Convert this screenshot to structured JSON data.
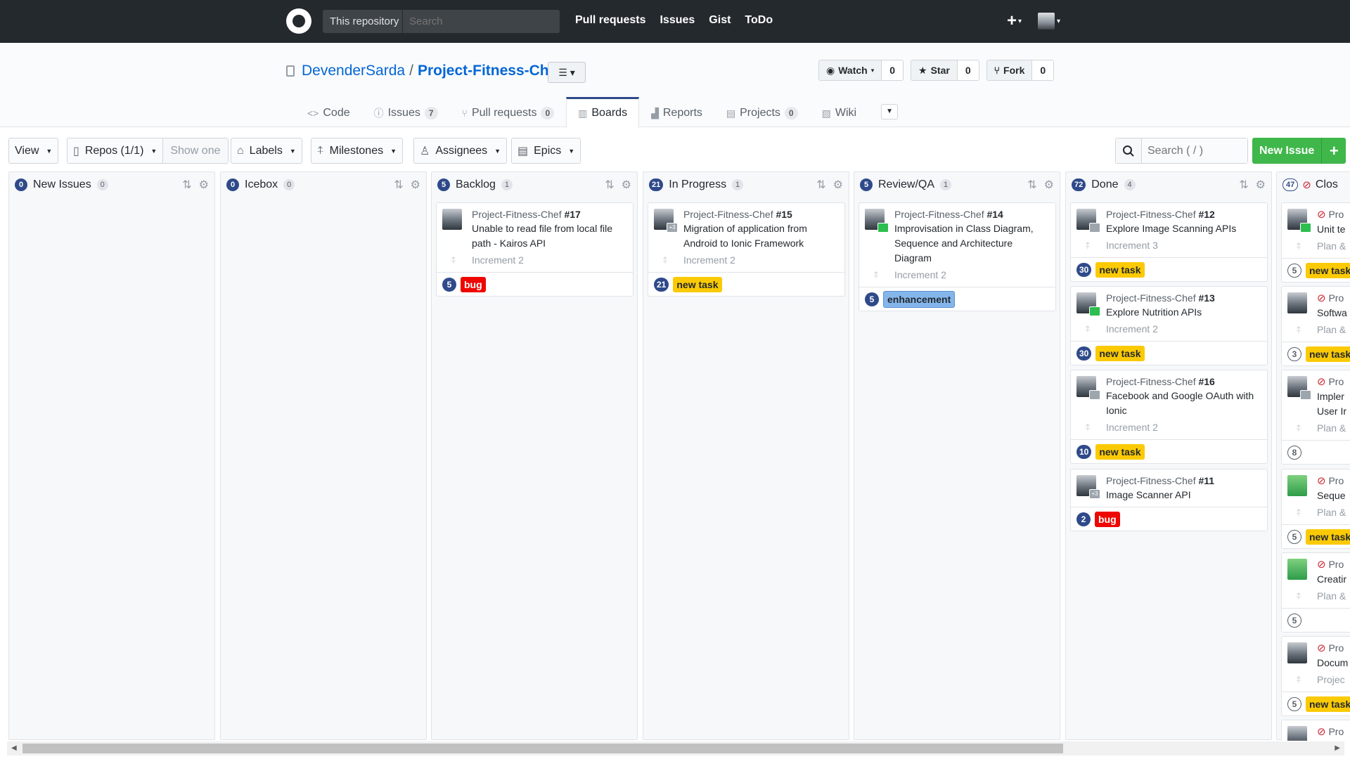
{
  "header": {
    "scope_label": "This repository",
    "search_placeholder": "Search",
    "nav": [
      "Pull requests",
      "Issues",
      "Gist",
      "ToDo"
    ],
    "plus_label": "+"
  },
  "repo": {
    "owner": "DevenderSarda",
    "separator": "/",
    "name": "Project-Fitness-Chef",
    "watch_label": "Watch",
    "watch_count": "0",
    "star_label": "Star",
    "star_count": "0",
    "fork_label": "Fork",
    "fork_count": "0"
  },
  "tabs": [
    {
      "label": "Code",
      "count": "",
      "icon": "<>"
    },
    {
      "label": "Issues",
      "count": "7",
      "icon": "ⓘ"
    },
    {
      "label": "Pull requests",
      "count": "0",
      "icon": "⑂"
    },
    {
      "label": "Boards",
      "count": "",
      "icon": "▥"
    },
    {
      "label": "Reports",
      "count": "",
      "icon": "▟"
    },
    {
      "label": "Projects",
      "count": "0",
      "icon": "▤"
    },
    {
      "label": "Wiki",
      "count": "",
      "icon": "▧"
    }
  ],
  "toolbar": {
    "view": "View",
    "repos": "Repos (1/1)",
    "show_one": "Show one",
    "labels": "Labels",
    "milestones": "Milestones",
    "assignees": "Assignees",
    "epics": "Epics",
    "search_placeholder": "Search ( / )",
    "new_issue": "New Issue",
    "new_issue_plus": "+"
  },
  "pipelines": [
    {
      "count": "0",
      "name": "New Issues",
      "issues": "0"
    },
    {
      "count": "0",
      "name": "Icebox",
      "issues": "0"
    },
    {
      "count": "5",
      "name": "Backlog",
      "issues": "1"
    },
    {
      "count": "21",
      "name": "In Progress",
      "issues": "1"
    },
    {
      "count": "5",
      "name": "Review/QA",
      "issues": "1"
    },
    {
      "count": "72",
      "name": "Done",
      "issues": "4"
    },
    {
      "count": "47",
      "name": "Clos",
      "issues": ""
    }
  ],
  "cards": {
    "backlog": [
      {
        "repo": "Project-Fitness-Chef",
        "num": "#17",
        "title": "Unable to read file from local file path - Kairos API",
        "milestone": "Increment 2",
        "estimate": "5",
        "label": "bug"
      }
    ],
    "in_progress": [
      {
        "repo": "Project-Fitness-Chef",
        "num": "#15",
        "title": "Migration of application from Android to Ionic Framework",
        "milestone": "Increment 2",
        "estimate": "21",
        "label": "new task",
        "badge": "+3"
      }
    ],
    "review": [
      {
        "repo": "Project-Fitness-Chef",
        "num": "#14",
        "title": "Improvisation in Class Diagram, Sequence and Architecture Diagram",
        "milestone": "Increment 2",
        "estimate": "5",
        "label": "enhancement"
      }
    ],
    "done": [
      {
        "repo": "Project-Fitness-Chef",
        "num": "#12",
        "title": "Explore Image Scanning APIs",
        "milestone": "Increment 3",
        "estimate": "30",
        "label": "new task"
      },
      {
        "repo": "Project-Fitness-Chef",
        "num": "#13",
        "title": "Explore Nutrition APIs",
        "milestone": "Increment 2",
        "estimate": "30",
        "label": "new task"
      },
      {
        "repo": "Project-Fitness-Chef",
        "num": "#16",
        "title": "Facebook and Google OAuth with Ionic",
        "milestone": "Increment 2",
        "estimate": "10",
        "label": "new task"
      },
      {
        "repo": "Project-Fitness-Chef",
        "num": "#11",
        "title": "Image Scanner API",
        "milestone": "",
        "estimate": "2",
        "label": "bug",
        "badge": "+3"
      }
    ],
    "closed": [
      {
        "repo": "Pro",
        "title": "Unit te",
        "milestone": "Plan &",
        "estimate": "5",
        "label": "new task"
      },
      {
        "repo": "Pro",
        "title": "Softwa",
        "milestone": "Plan &",
        "estimate": "3",
        "label": "new task"
      },
      {
        "repo": "Pro",
        "title": "Impler",
        "title2": "User Ir",
        "milestone": "Plan &",
        "estimate": "8",
        "label": ""
      },
      {
        "repo": "Pro",
        "title": "Seque",
        "milestone": "Plan &",
        "estimate": "5",
        "label": "new task"
      },
      {
        "repo": "Pro",
        "title": "Creatir",
        "milestone": "Plan &",
        "estimate": "5",
        "label": ""
      },
      {
        "repo": "Pro",
        "title": "Docum",
        "milestone": "Projec",
        "estimate": "5",
        "label": "new task"
      },
      {
        "repo": "Pro",
        "title": "",
        "milestone": "",
        "estimate": "",
        "label": ""
      }
    ]
  }
}
